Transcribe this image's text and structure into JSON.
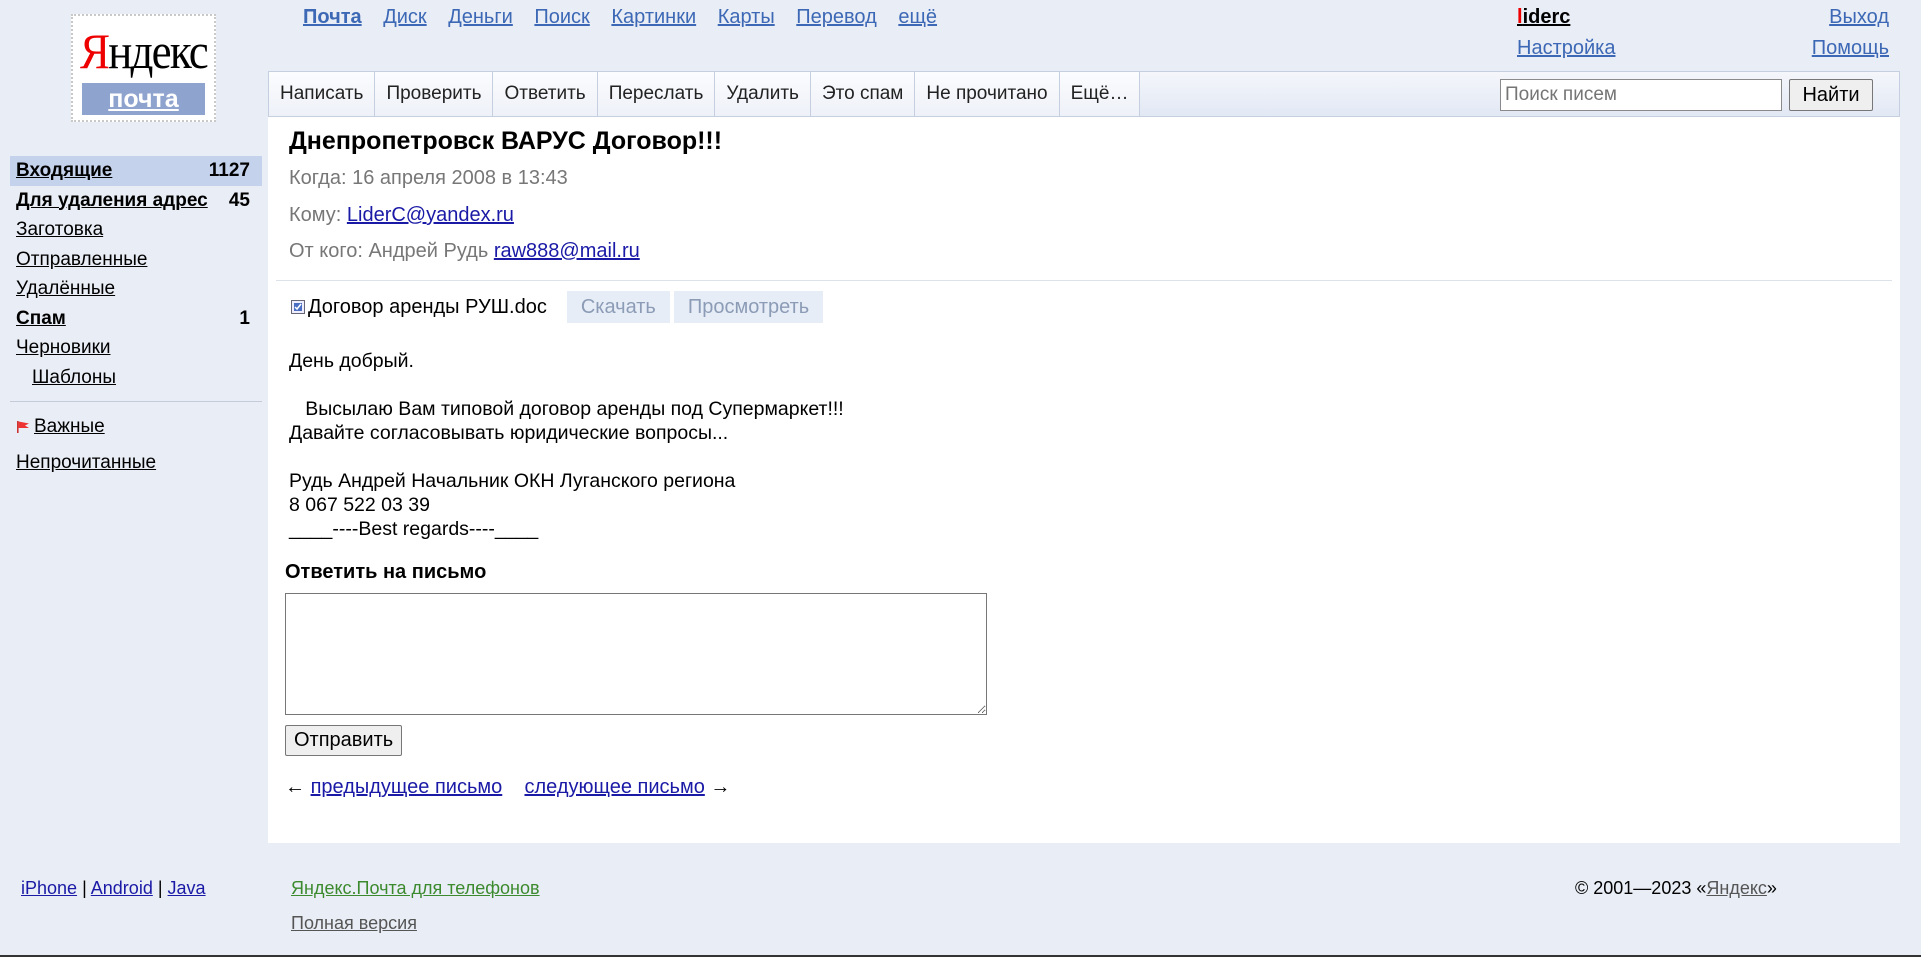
{
  "logo": {
    "brand_first": "Я",
    "brand_rest": "ндекс",
    "service": "почта"
  },
  "services": [
    {
      "label": "Почта",
      "current": true
    },
    {
      "label": "Диск"
    },
    {
      "label": "Деньги"
    },
    {
      "label": "Поиск"
    },
    {
      "label": "Картинки"
    },
    {
      "label": "Карты"
    },
    {
      "label": "Перевод"
    },
    {
      "label": "ещё"
    }
  ],
  "user": {
    "first_letter": "l",
    "rest": "iderc",
    "settings": "Настройка",
    "logout": "Выход",
    "help": "Помощь"
  },
  "toolbar": {
    "buttons": [
      "Написать",
      "Проверить",
      "Ответить",
      "Переслать",
      "Удалить",
      "Это спам",
      "Не прочитано",
      "Ещё…"
    ],
    "search_placeholder": "Поиск писем",
    "search_button": "Найти"
  },
  "folders": [
    {
      "label": "Входящие",
      "count": "1127",
      "selected": true,
      "bold": true
    },
    {
      "label": "Для удаления адрес",
      "count": "45",
      "bold": true
    },
    {
      "label": "Заготовка"
    },
    {
      "label": "Отправленные"
    },
    {
      "label": "Удалённые"
    },
    {
      "label": "Спам",
      "count": "1",
      "bold": true
    },
    {
      "label": "Черновики"
    },
    {
      "label": "Шаблоны",
      "indent": true
    }
  ],
  "labels": {
    "important": "Важные",
    "unread": "Непрочитанные"
  },
  "message": {
    "subject": "Днепропетровск ВАРУС Договор!!!",
    "when_label": "Когда:",
    "when_value": "16 апреля 2008 в 13:43",
    "to_label": "Кому:",
    "to_email": "LiderC@yandex.ru",
    "from_label": "От кого:",
    "from_name": "Андрей Рудь",
    "from_email": "raw888@mail.ru",
    "attachment": {
      "name": "Договор аренды РУШ.doc",
      "download": "Скачать",
      "view": "Просмотреть"
    },
    "body": "День добрый.\n\n   Высылаю Вам типовой договор аренды под Супермаркет!!!\nДавайте согласовывать юридические вопросы...\n\nРудь Андрей Начальник ОКН Луганского региона\n8 067 522 03 39\n____----Best regards----____"
  },
  "reply": {
    "title": "Ответить на письмо",
    "send": "Отправить"
  },
  "nav": {
    "prev_arrow": "←",
    "prev": "предыдущее письмо",
    "next": "следующее письмо",
    "next_arrow": "→"
  },
  "footer": {
    "apps": [
      "iPhone",
      "Android",
      "Java"
    ],
    "separator": "|",
    "mobile": "Яндекс.Почта для телефонов",
    "full": "Полная версия",
    "copyright_prefix": "© 2001—2023 «",
    "copyright_link": "Яндекс",
    "copyright_suffix": "»"
  }
}
